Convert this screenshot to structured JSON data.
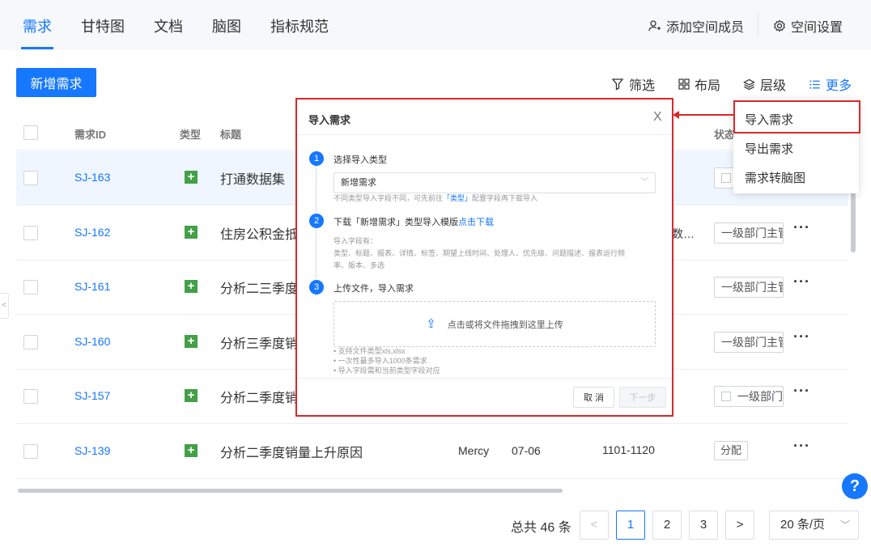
{
  "nav": {
    "tabs": [
      "需求",
      "甘特图",
      "文档",
      "脑图",
      "指标规范"
    ],
    "add_member": "添加空间成员",
    "settings": "空间设置"
  },
  "toolbar": {
    "new_label": "新增需求",
    "filter": "筛选",
    "layout": "布局",
    "level": "层级",
    "more": "更多"
  },
  "table": {
    "headers": {
      "checkbox": "",
      "id": "需求ID",
      "type": "类型",
      "title": "标题",
      "status": "状态"
    },
    "rows": [
      {
        "id": "SJ-163",
        "title": "打通数据集",
        "owner": "",
        "date": "",
        "range": "",
        "status": ""
      },
      {
        "id": "SJ-162",
        "title": "住房公积金抵",
        "owner": "",
        "date": "",
        "range": "数…",
        "status": "一级部门主管"
      },
      {
        "id": "SJ-161",
        "title": "分析二三季度",
        "owner": "",
        "date": "",
        "range": "",
        "status": "一级部门主管"
      },
      {
        "id": "SJ-160",
        "title": "分析三季度销",
        "owner": "",
        "date": "",
        "range": "",
        "status": "一级部门主管"
      },
      {
        "id": "SJ-157",
        "title": "分析二季度销",
        "owner": "",
        "date": "",
        "range": "",
        "status": "一级部门主"
      },
      {
        "id": "SJ-139",
        "title": "分析二季度销量上升原因",
        "owner": "Mercy",
        "date": "07-06",
        "range": "1101-1120",
        "status": "分配"
      }
    ]
  },
  "more_menu": {
    "items": [
      "导入需求",
      "导出需求",
      "需求转脑图"
    ]
  },
  "import_dialog": {
    "title": "导入需求",
    "close": "X",
    "step1": {
      "num": "1",
      "title": "选择导入类型",
      "select_value": "新增需求",
      "hint_prefix": "不同类型导入字段不同，可先前往",
      "hint_link": "「类型」",
      "hint_suffix": "配置字段再下载导入"
    },
    "step2": {
      "num": "2",
      "title_prefix": "下载「新增需求」类型导入模版",
      "title_link": "点击下载",
      "fields_label": "导入字段有：",
      "fields_line1": "类型、标题、报表、详情、标签、期望上线时间、处理人、优先级、问题描述、报表运行频",
      "fields_line2": "率、版本、多选"
    },
    "step3": {
      "num": "3",
      "title": "上传文件，导入需求",
      "upload_text": "点击或将文件拖拽到这里上传",
      "note1": "• 支持文件类型xls,xlsx",
      "note2": "• 一次性最多导入1000条需求",
      "note3": "• 导入字段需和当前类型字段对应"
    },
    "cancel": "取 消",
    "next": "下一步"
  },
  "pagination": {
    "total": "总共 46 条",
    "prev": "<",
    "pages": [
      "1",
      "2",
      "3"
    ],
    "next": ">",
    "page_size": "20 条/页"
  },
  "help": "?",
  "collapse": "<",
  "colors": {
    "primary": "#1677ff",
    "highlight_red": "#d9282a",
    "type_green": "#43a047"
  }
}
